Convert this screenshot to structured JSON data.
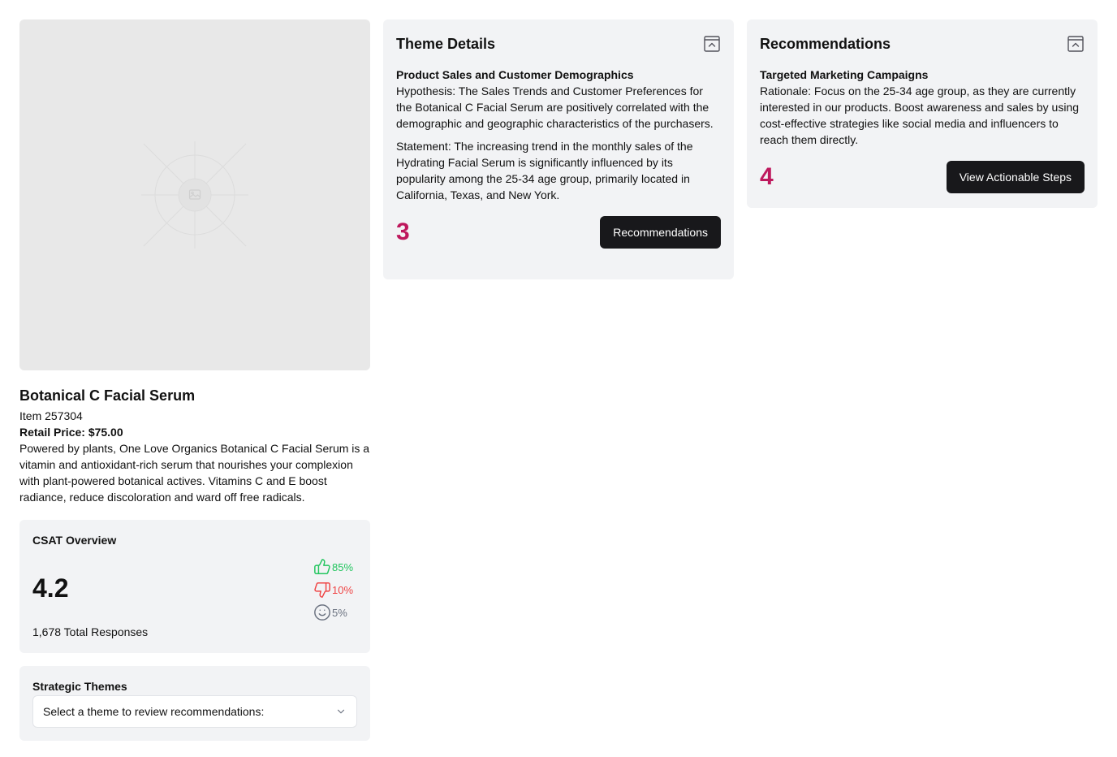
{
  "product": {
    "title": "Botanical C Facial Serum",
    "item": "Item 257304",
    "price": "Retail Price: $75.00",
    "description": "Powered by plants, One Love Organics Botanical C Facial Serum is a vitamin and antioxidant-rich serum that nourishes your complexion with plant-powered botanical actives. Vitamins C and E boost radiance, reduce discoloration and ward off free radicals.",
    "image_icon": "image-placeholder-icon"
  },
  "csat": {
    "label": "CSAT Overview",
    "score": "4.2",
    "total": "1,678 Total Responses",
    "positive": "85%",
    "negative": "10%",
    "neutral": "5%",
    "colors": {
      "positive": "#22c55e",
      "negative": "#ef4444",
      "neutral": "#6b7280"
    }
  },
  "themes": {
    "label": "Strategic Themes",
    "select_value": "Select a theme to review recommendations:"
  },
  "theme_details": {
    "title": "Theme Details",
    "subtitle": "Product Sales and Customer Demographics",
    "hypothesis": "Hypothesis: The Sales Trends and Customer Preferences for the Botanical C Facial Serum are positively correlated with the demographic and geographic characteristics of the purchasers.",
    "statement": "Statement: The increasing trend in the monthly sales of the Hydrating Facial Serum is significantly influenced by its popularity among the 25-34 age group, primarily located in California, Texas, and New York.",
    "count": "3",
    "button": "Recommendations"
  },
  "recommendations": {
    "title": "Recommendations",
    "subtitle": "Targeted Marketing Campaigns",
    "rationale": "Rationale: Focus on the 25-34 age group, as they are currently interested in our products. Boost awareness and sales by using cost-effective strategies like social media and influencers to reach them directly.",
    "count": "4",
    "button": "View Actionable Steps"
  },
  "accent_color": "#be185d"
}
